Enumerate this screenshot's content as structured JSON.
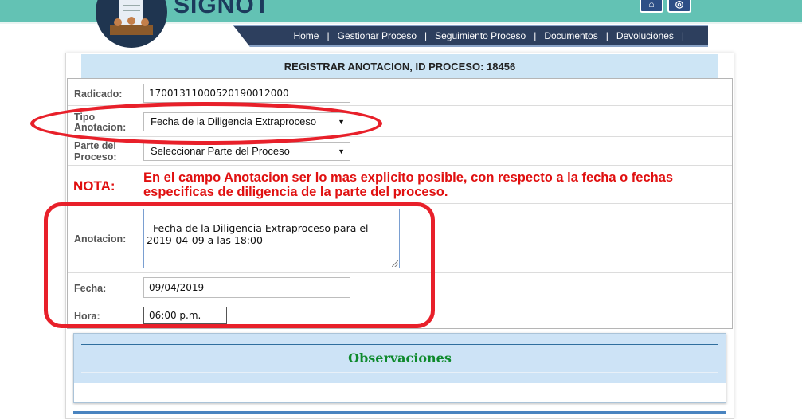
{
  "header": {
    "brand": "SIGNOT"
  },
  "nav": {
    "items": [
      "Home",
      "Gestionar Proceso",
      "Seguimiento Proceso",
      "Documentos",
      "Devoluciones"
    ],
    "separator": "|"
  },
  "form": {
    "title": "REGISTRAR ANOTACION, ID PROCESO: 18456",
    "radicado": {
      "label": "Radicado:",
      "value": "17001311000520190012000"
    },
    "tipo_anotacion": {
      "label_line1": "Tipo",
      "label_line2": "Anotacion:",
      "selected": "Fecha de la Diligencia Extraproceso"
    },
    "parte_proceso": {
      "label_line1": "Parte del",
      "label_line2": "Proceso:",
      "selected": "Seleccionar Parte del Proceso"
    },
    "nota": {
      "label": "NOTA:",
      "text": "En el campo Anotacion ser lo mas explicito posible, con respecto a la fecha o fechas especificas de diligencia de la parte del proceso."
    },
    "anotacion": {
      "label": "Anotacion:",
      "value": "Fecha de la Diligencia Extraproceso para el 2019-04-09 a las 18:00"
    },
    "fecha": {
      "label": "Fecha:",
      "value": "09/04/2019"
    },
    "hora": {
      "label": "Hora:",
      "value": "06:00 p.m."
    }
  },
  "observaciones": {
    "title": "Observaciones"
  },
  "colors": {
    "header_teal": "#63c2b4",
    "nav_bg": "#2d3f5e",
    "title_bar": "#cde5f5",
    "note_red": "#e01010",
    "annotation_red": "#e8202a",
    "obs_green": "#0e8a2c"
  }
}
